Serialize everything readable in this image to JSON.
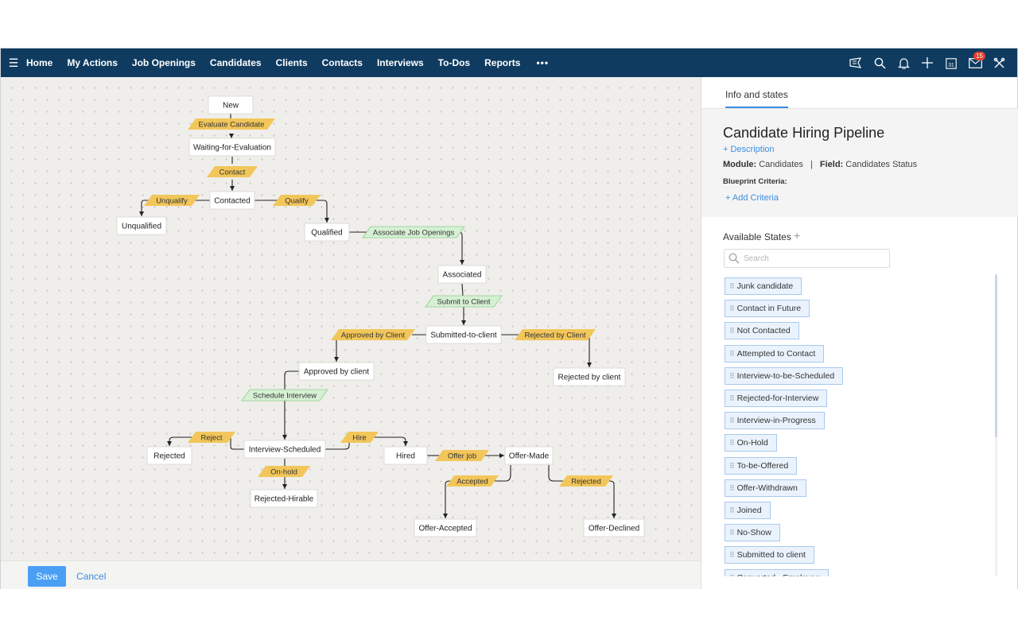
{
  "nav": {
    "items": [
      "Home",
      "My Actions",
      "Job Openings",
      "Candidates",
      "Clients",
      "Contacts",
      "Interviews",
      "To-Dos",
      "Reports"
    ],
    "more_label": "•••",
    "tools": [
      "feeds-icon",
      "search-icon",
      "bell-icon",
      "plus-icon",
      "calendar-icon",
      "mail-icon",
      "settings-tools-icon"
    ],
    "calendar_day": "31",
    "mail_badge": "15"
  },
  "canvas": {
    "states": [
      {
        "id": "new",
        "label": "New"
      },
      {
        "id": "waiting",
        "label": "Waiting-for-Evaluation"
      },
      {
        "id": "contacted",
        "label": "Contacted"
      },
      {
        "id": "unqualified",
        "label": "Unqualified"
      },
      {
        "id": "qualified",
        "label": "Qualified"
      },
      {
        "id": "associated",
        "label": "Associated"
      },
      {
        "id": "submitted",
        "label": "Submitted-to-client"
      },
      {
        "id": "approved",
        "label": "Approved by client"
      },
      {
        "id": "rejected_client",
        "label": "Rejected by client"
      },
      {
        "id": "interview_scheduled",
        "label": "Interview-Scheduled"
      },
      {
        "id": "rejected",
        "label": "Rejected"
      },
      {
        "id": "hired",
        "label": "Hired"
      },
      {
        "id": "offer_made",
        "label": "Offer-Made"
      },
      {
        "id": "rejected_hirable",
        "label": "Rejected-Hirable"
      },
      {
        "id": "offer_accepted",
        "label": "Offer-Accepted"
      },
      {
        "id": "offer_declined",
        "label": "Offer-Declined"
      }
    ],
    "transitions": [
      {
        "id": "evaluate",
        "label": "Evaluate Candidate",
        "kind": "yellow"
      },
      {
        "id": "contact",
        "label": "Contact",
        "kind": "yellow"
      },
      {
        "id": "unqualify",
        "label": "Unqualify",
        "kind": "yellow"
      },
      {
        "id": "qualify",
        "label": "Qualify",
        "kind": "yellow"
      },
      {
        "id": "associate",
        "label": "Associate Job Openings",
        "kind": "green"
      },
      {
        "id": "submit",
        "label": "Submit to Client",
        "kind": "green"
      },
      {
        "id": "approve",
        "label": "Approved by Client",
        "kind": "yellow"
      },
      {
        "id": "reject_client",
        "label": "Rejected by Client",
        "kind": "yellow"
      },
      {
        "id": "schedule",
        "label": "Schedule Interview",
        "kind": "green"
      },
      {
        "id": "reject",
        "label": "Reject",
        "kind": "yellow"
      },
      {
        "id": "hire",
        "label": "Hire",
        "kind": "yellow"
      },
      {
        "id": "onhold",
        "label": "On-hold",
        "kind": "yellow"
      },
      {
        "id": "offerjob",
        "label": "Offer job",
        "kind": "yellow"
      },
      {
        "id": "accepted",
        "label": "Accepted",
        "kind": "yellow"
      },
      {
        "id": "rejected_t",
        "label": "Rejected",
        "kind": "yellow"
      }
    ],
    "colors": {
      "yellow_fill": "#f2c65a",
      "green_fill": "#d6f0d4",
      "green_stroke": "#8fcf8b"
    }
  },
  "footer": {
    "save_label": "Save",
    "cancel_label": "Cancel"
  },
  "panel": {
    "tab_label": "Info and states",
    "title": "Candidate Hiring Pipeline",
    "description_link": "+ Description",
    "module_label": "Module:",
    "module_value": "Candidates",
    "separator": "|",
    "field_label": "Field:",
    "field_value": "Candidates Status",
    "criteria_label": "Blueprint Criteria:",
    "add_criteria": "+ Add Criteria",
    "states_title": "Available States",
    "states_add": "+",
    "search_placeholder": "Search",
    "available_states": [
      "Junk candidate",
      "Contact in Future",
      "Not Contacted",
      "Attempted to Contact",
      "Interview-to-be-Scheduled",
      "Rejected-for-Interview",
      "Interview-in-Progress",
      "On-Hold",
      "To-be-Offered",
      "Offer-Withdrawn",
      "Joined",
      "No-Show",
      "Submitted to client",
      "Converted - Employee"
    ]
  }
}
